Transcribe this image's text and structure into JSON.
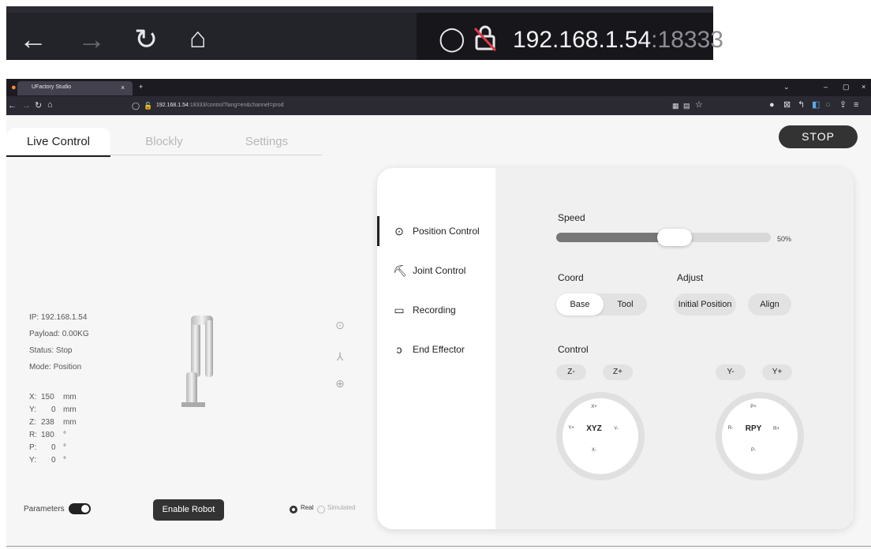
{
  "inset": {
    "url_host": "192.168.1.54",
    "url_port": ":18333"
  },
  "browser": {
    "tab_title": "UFactory Studio",
    "tab_close": "×",
    "new_tab": "+",
    "url_host": "192.168.1.54",
    "url_rest": ":18333/control?lang=en&channel=prod",
    "window_controls": [
      "⌄",
      "–",
      "▢",
      "×"
    ]
  },
  "app": {
    "tabs": [
      {
        "label": "Live Control",
        "active": true
      },
      {
        "label": "Blockly",
        "active": false
      },
      {
        "label": "Settings",
        "active": false
      }
    ],
    "stop_label": "STOP",
    "robot_info": {
      "ip": "IP: 192.168.1.54",
      "payload": "Payload: 0.00KG",
      "status": "Status: Stop",
      "mode": "Mode: Position"
    },
    "position": [
      {
        "axis": "X:",
        "value": "150",
        "unit": "mm"
      },
      {
        "axis": "Y:",
        "value": "0",
        "unit": "mm"
      },
      {
        "axis": "Z:",
        "value": "238",
        "unit": "mm"
      },
      {
        "axis": "R:",
        "value": "180",
        "unit": "°"
      },
      {
        "axis": "P:",
        "value": "0",
        "unit": "°"
      },
      {
        "axis": "Y:",
        "value": "0",
        "unit": "°"
      }
    ],
    "parameters_label": "Parameters",
    "parameters_on": true,
    "enable_label": "Enable Robot",
    "mode_real": "Real",
    "mode_simulated": "Simulated",
    "menu": [
      {
        "label": "Position Control",
        "icon": "position-control-icon",
        "active": true
      },
      {
        "label": "Joint Control",
        "icon": "joint-control-icon",
        "active": false
      },
      {
        "label": "Recording",
        "icon": "recording-icon",
        "active": false
      },
      {
        "label": "End Effector",
        "icon": "end-effector-icon",
        "active": false
      }
    ],
    "speed": {
      "label": "Speed",
      "value_text": "50%",
      "value": 0.5
    },
    "coord": {
      "label": "Coord",
      "options": [
        "Base",
        "Tool"
      ],
      "selected": "Base"
    },
    "adjust": {
      "label": "Adjust",
      "initial": "Initial Position",
      "align": "Align"
    },
    "control": {
      "label": "Control",
      "z_minus": "Z-",
      "z_plus": "Z+",
      "y_minus": "Y-",
      "y_plus": "Y+",
      "xyz": {
        "center": "XYZ",
        "top": "X+",
        "bottom": "X-",
        "left": "Y+",
        "right": "Y-"
      },
      "rpy": {
        "center": "RPY",
        "top": "P+",
        "bottom": "P-",
        "left": "R-",
        "right": "R+"
      }
    }
  }
}
